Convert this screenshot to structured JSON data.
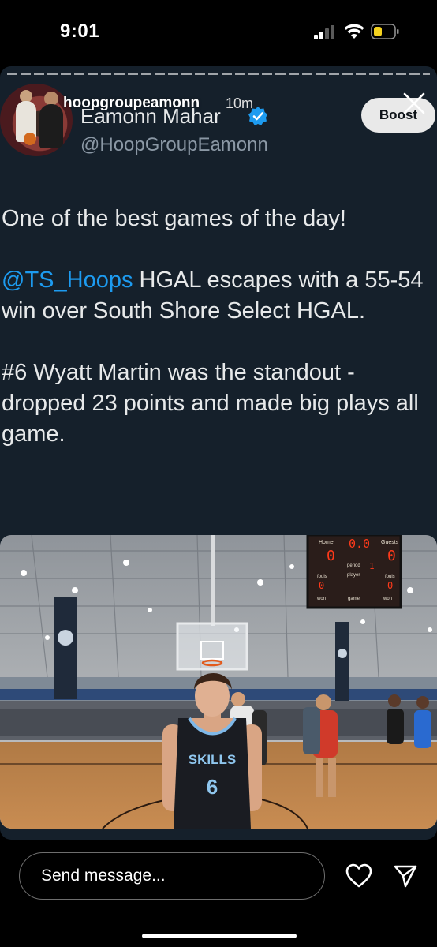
{
  "status_bar": {
    "time": "9:01",
    "icons": [
      "cellular-signal-icon",
      "wifi-icon",
      "battery-low-icon"
    ],
    "battery_color": "#f4d21f"
  },
  "story": {
    "username": "hoopgroupeamonn",
    "time_ago": "10m",
    "boost_label": "Boost",
    "close_icon": "close-icon"
  },
  "tweet": {
    "author_name": "Eamonn Mahar",
    "author_handle": "@HoopGroupEamonn",
    "verified": true,
    "paragraph1": "One of the best games of the day!",
    "mention": "@TS_Hoops",
    "paragraph2_rest": " HGAL escapes with a 55-54 win over South Shore Select HGAL.",
    "paragraph3": "#6 Wyatt Martin was the standout - dropped 23 points and made big plays all game."
  },
  "photo": {
    "scoreboard": {
      "home_label": "Home",
      "guests_label": "Guests",
      "clock": "0.0",
      "home_score": "0",
      "guests_score": "0",
      "period_label": "period",
      "player_label": "player",
      "period_value": "1",
      "fouls_label_left": "fouls",
      "fouls_label_right": "fouls",
      "home_fouls": "0",
      "guest_fouls": "0",
      "won_left": "won",
      "game_label": "game",
      "won_right": "won"
    },
    "jersey_text": "SKILLS",
    "jersey_number": "6"
  },
  "reply_bar": {
    "placeholder": "Send message...",
    "icons": [
      "heart-icon",
      "paper-plane-icon"
    ]
  },
  "colors": {
    "card_background": "#15202b",
    "link_blue": "#1d9bf0",
    "secondary_text": "#8b98a5",
    "verified_blue": "#1d9bf0"
  }
}
